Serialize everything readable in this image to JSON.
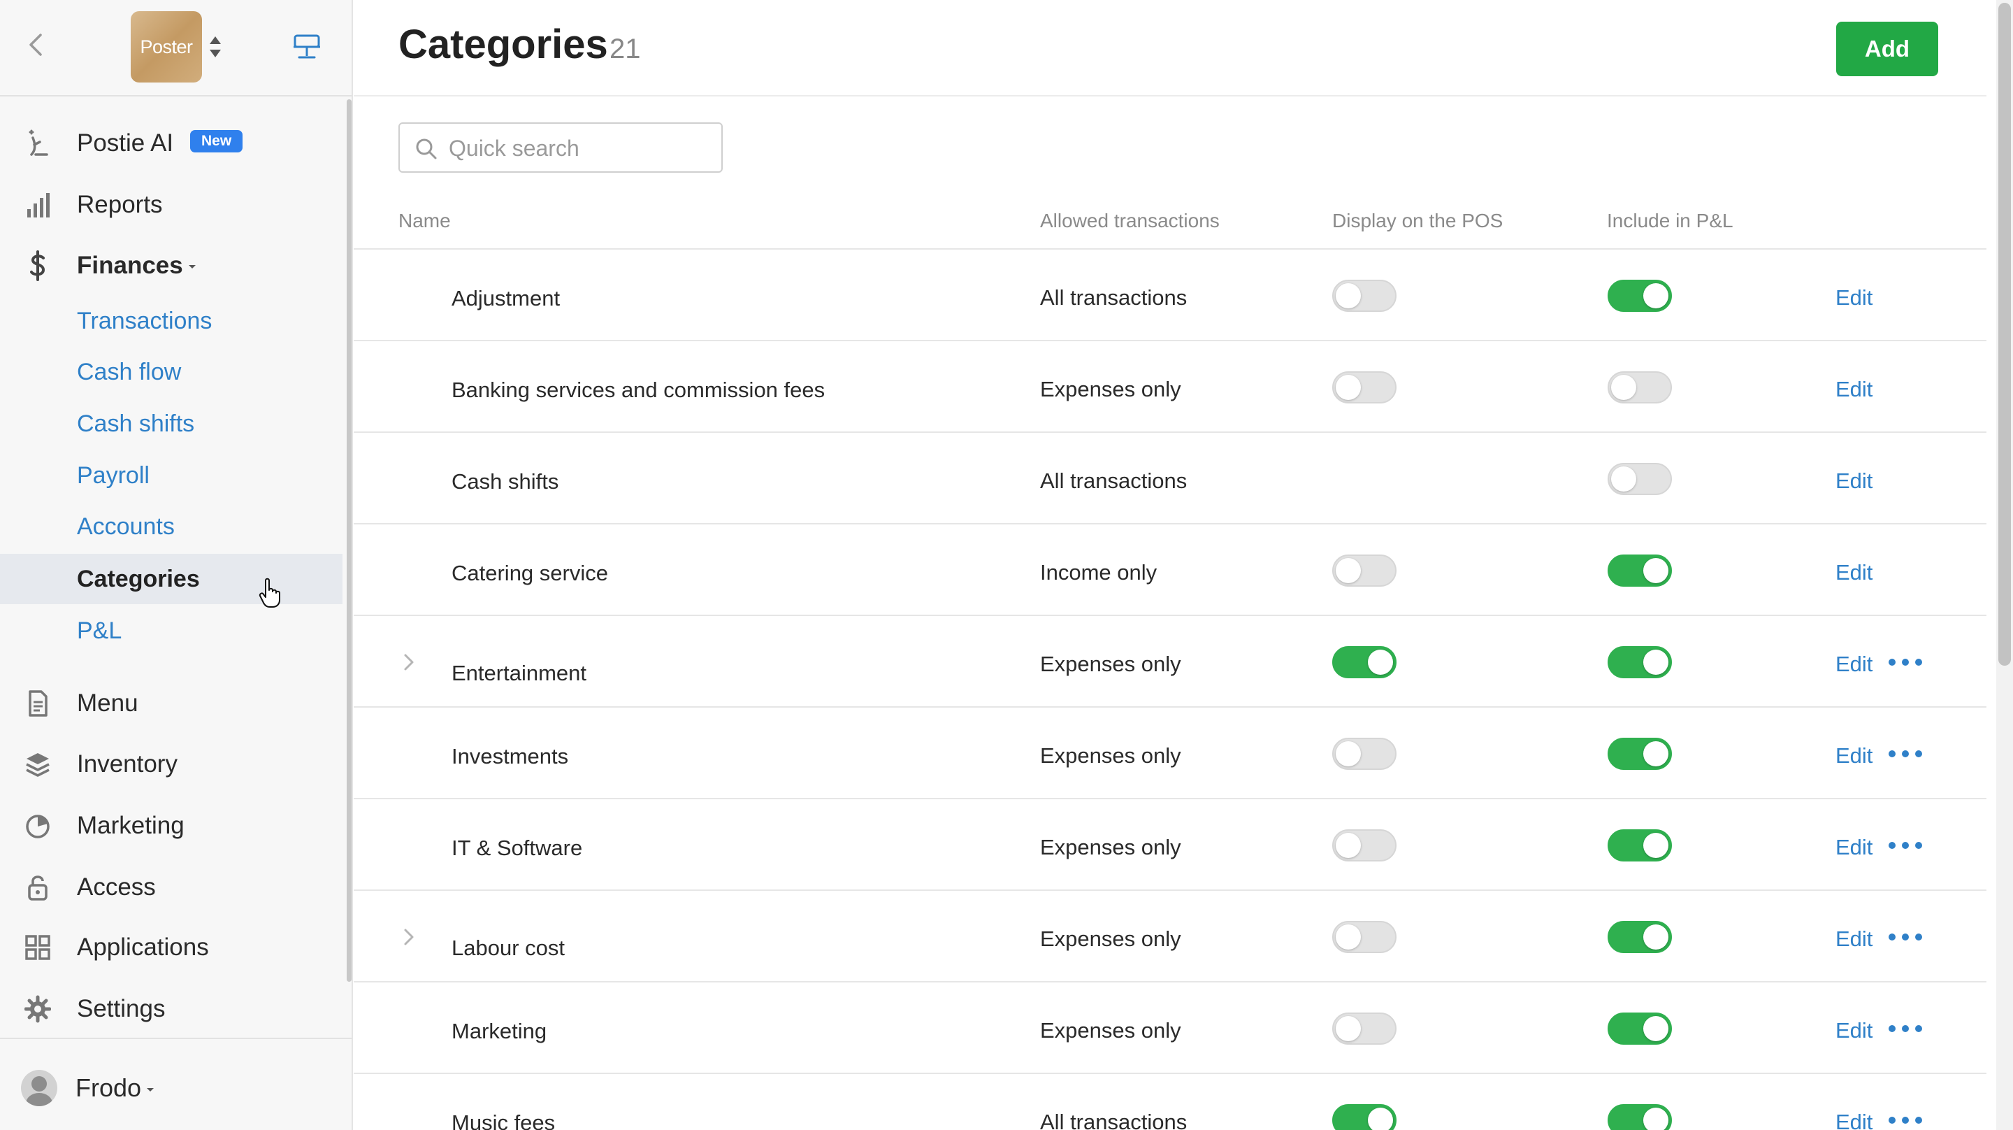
{
  "sidebar": {
    "logo_text": "Poster",
    "nav": {
      "postie_ai": "Postie AI",
      "postie_badge": "New",
      "reports": "Reports",
      "finances": "Finances",
      "menu": "Menu",
      "inventory": "Inventory",
      "marketing": "Marketing",
      "access": "Access",
      "applications": "Applications",
      "settings": "Settings"
    },
    "finances_sub": [
      "Transactions",
      "Cash flow",
      "Cash shifts",
      "Payroll",
      "Accounts",
      "Categories",
      "P&L"
    ],
    "active_sub": "Categories",
    "user_name": "Frodo"
  },
  "header": {
    "title": "Categories",
    "count": "21",
    "add_label": "Add"
  },
  "search": {
    "placeholder": "Quick search",
    "value": ""
  },
  "table": {
    "columns": [
      "Name",
      "Allowed transactions",
      "Display on the POS",
      "Include in P&L"
    ],
    "edit_label": "Edit",
    "rows": [
      {
        "name": "Adjustment",
        "allowed": "All transactions",
        "display_pos": false,
        "include_pl": true,
        "expandable": false,
        "has_more": false
      },
      {
        "name": "Banking services and commission fees",
        "allowed": "Expenses only",
        "display_pos": false,
        "include_pl": false,
        "expandable": false,
        "has_more": false
      },
      {
        "name": "Cash shifts",
        "allowed": "All transactions",
        "display_pos": null,
        "include_pl": false,
        "expandable": false,
        "has_more": false
      },
      {
        "name": "Catering service",
        "allowed": "Income only",
        "display_pos": false,
        "include_pl": true,
        "expandable": false,
        "has_more": false
      },
      {
        "name": "Entertainment",
        "allowed": "Expenses only",
        "display_pos": true,
        "include_pl": true,
        "expandable": true,
        "has_more": true
      },
      {
        "name": "Investments",
        "allowed": "Expenses only",
        "display_pos": false,
        "include_pl": true,
        "expandable": false,
        "has_more": true
      },
      {
        "name": "IT & Software",
        "allowed": "Expenses only",
        "display_pos": false,
        "include_pl": true,
        "expandable": false,
        "has_more": true
      },
      {
        "name": "Labour cost",
        "allowed": "Expenses only",
        "display_pos": false,
        "include_pl": true,
        "expandable": true,
        "has_more": true
      },
      {
        "name": "Marketing",
        "allowed": "Expenses only",
        "display_pos": false,
        "include_pl": true,
        "expandable": false,
        "has_more": true
      },
      {
        "name": "Music fees",
        "allowed": "All transactions",
        "display_pos": true,
        "include_pl": true,
        "expandable": false,
        "has_more": true
      }
    ]
  },
  "colors": {
    "accent_link": "#2f80c8",
    "add_button": "#22a845",
    "toggle_on": "#2fb04f",
    "badge_new": "#2f80ed"
  }
}
